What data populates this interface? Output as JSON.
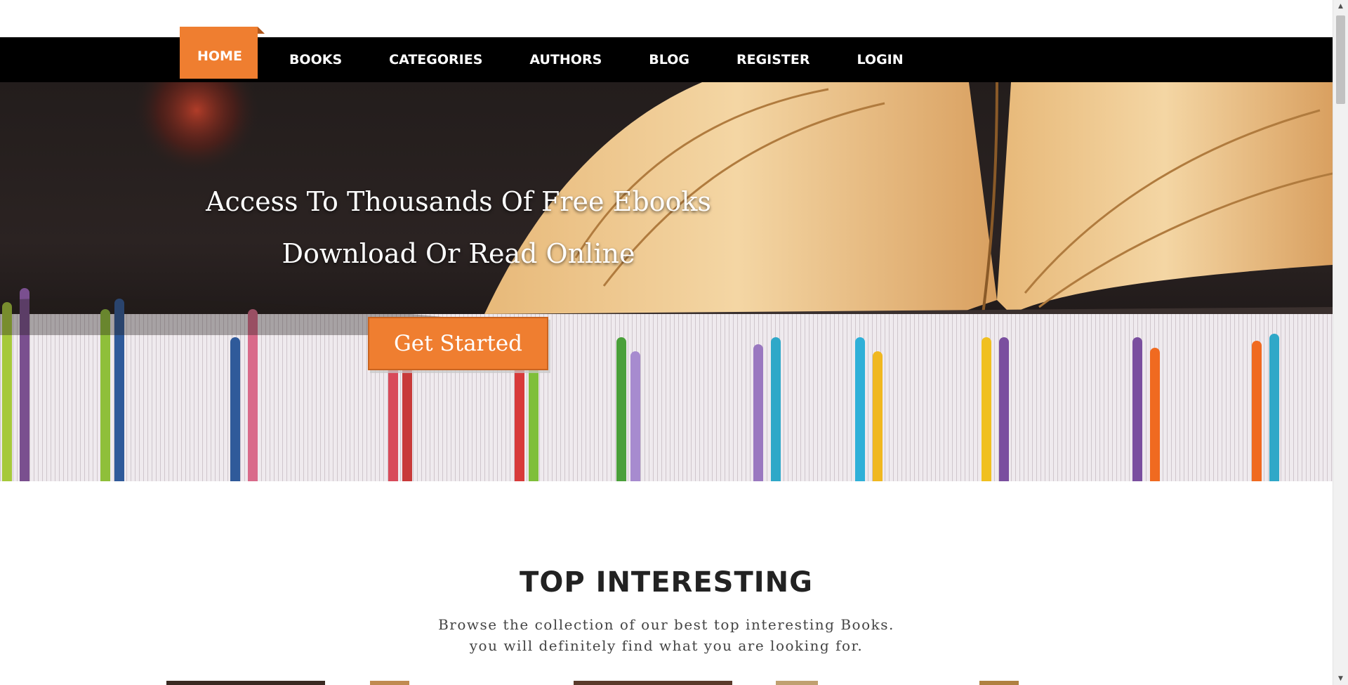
{
  "nav": {
    "items": [
      {
        "label": "HOME",
        "active": true
      },
      {
        "label": "BOOKS",
        "active": false
      },
      {
        "label": "CATEGORIES",
        "active": false
      },
      {
        "label": "AUTHORS",
        "active": false
      },
      {
        "label": "BLOG",
        "active": false
      },
      {
        "label": "REGISTER",
        "active": false
      },
      {
        "label": "LOGIN",
        "active": false
      }
    ]
  },
  "hero": {
    "title_line_1": "Access To Thousands Of Free Ebooks",
    "title_line_2": "Download Or Read Online",
    "cta_label": "Get Started"
  },
  "section": {
    "title": "TOP INTERESTING",
    "subtitle_line_1": "Browse the collection of our best top interesting Books.",
    "subtitle_line_2": "you will definitely find what you are looking for."
  },
  "colors": {
    "accent": "#ef7e30",
    "nav_background": "#000000",
    "heading": "#222222"
  },
  "icons": {
    "scroll_up": "scroll-up-arrow-icon",
    "scroll_down": "scroll-down-arrow-icon"
  }
}
